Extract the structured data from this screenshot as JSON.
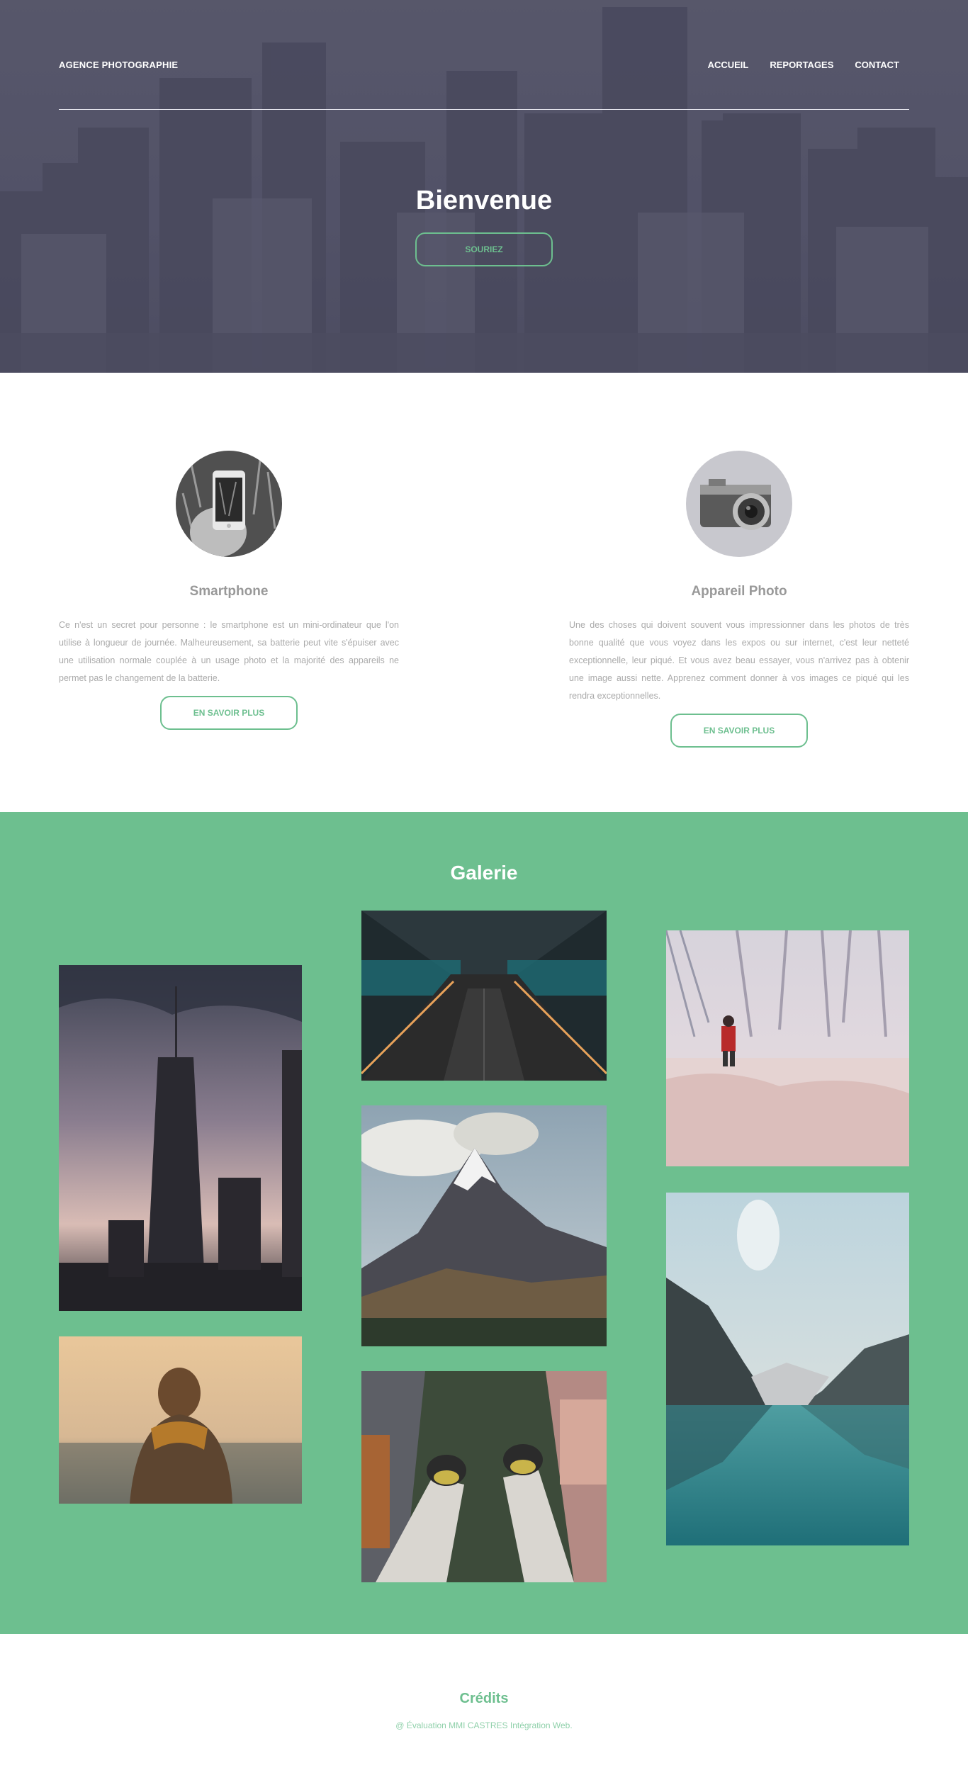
{
  "header": {
    "brand": "AGENCE PHOTOGRAPHIE",
    "nav": [
      "ACCUEIL",
      "REPORTAGES",
      "CONTACT"
    ],
    "title": "Bienvenue",
    "cta": "SOURIEZ"
  },
  "features": [
    {
      "title": "Smartphone",
      "text": "Ce n'est un secret pour personne : le smartphone est un mini-ordinateur que l'on utilise à longueur de journée. Malheureusement, sa batterie peut vite s'épuiser avec une utilisation normale couplée à un usage photo et la majorité des appareils ne permet pas le changement de la batterie.",
      "button": "EN SAVOIR PLUS",
      "icon": "smartphone-photo"
    },
    {
      "title": "Appareil Photo",
      "text": "Une des choses qui doivent souvent vous impressionner dans les photos de très bonne qualité que vous voyez dans les expos ou sur internet, c'est leur netteté exceptionnelle, leur piqué. Et vous avez beau essayer, vous n'arrivez pas à obtenir une image aussi nette. Apprenez comment donner à vos images ce piqué qui les rendra exceptionnelles.",
      "button": "EN SAVOIR PLUS",
      "icon": "camera-photo"
    }
  ],
  "gallery": {
    "title": "Galerie",
    "photos": [
      "skyscraper",
      "hooded-person-sunset",
      "escalator",
      "mountain-peak",
      "feet-above-city",
      "person-in-snow",
      "mountain-lake"
    ]
  },
  "footer": {
    "title": "Crédits",
    "text": "@ Évaluation MMI CASTRES Intégration Web."
  },
  "colors": {
    "accent": "#6dbf8f",
    "hero": "#53536a"
  }
}
